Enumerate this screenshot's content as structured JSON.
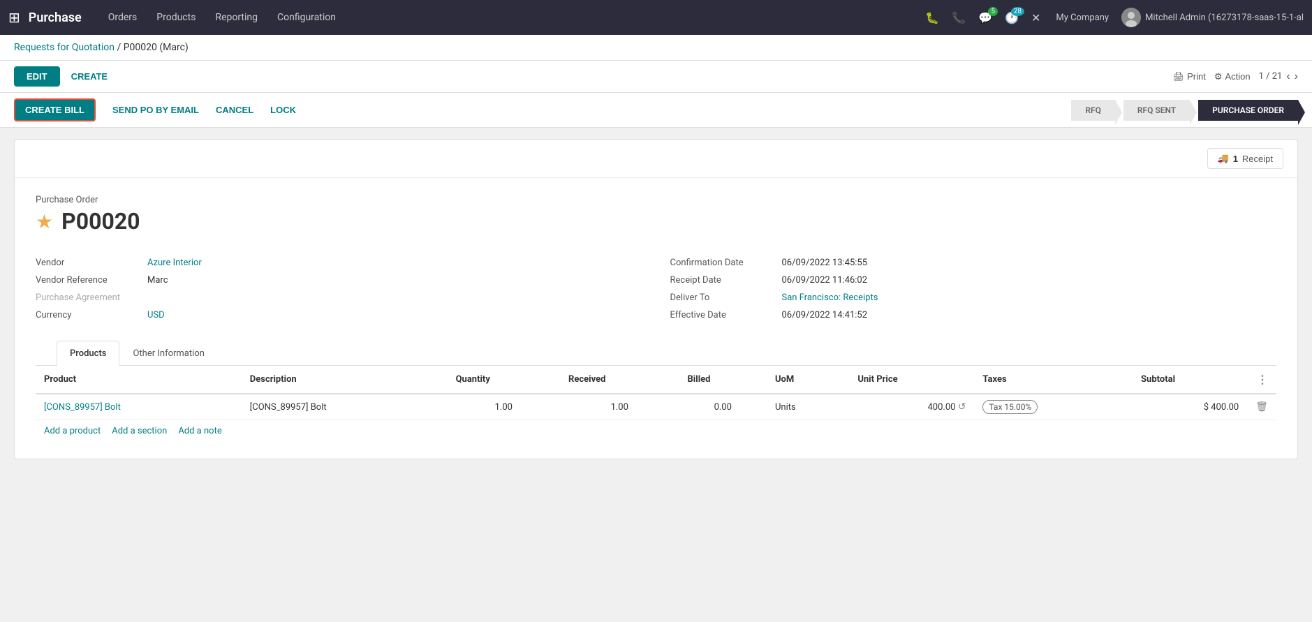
{
  "app": {
    "name": "Purchase",
    "grid_icon": "⊞"
  },
  "nav": {
    "items": [
      {
        "label": "Orders",
        "id": "orders"
      },
      {
        "label": "Products",
        "id": "products"
      },
      {
        "label": "Reporting",
        "id": "reporting"
      },
      {
        "label": "Configuration",
        "id": "configuration"
      }
    ]
  },
  "topbar": {
    "icons": [
      {
        "name": "bug-icon",
        "symbol": "🐛"
      },
      {
        "name": "phone-icon",
        "symbol": "📞"
      },
      {
        "name": "chat-icon",
        "symbol": "💬",
        "badge": "5",
        "badge_type": "green"
      },
      {
        "name": "clock-icon",
        "symbol": "🕐",
        "badge": "28",
        "badge_type": "blue"
      },
      {
        "name": "wrench-icon",
        "symbol": "✕"
      }
    ],
    "company": "My Company",
    "user": "Mitchell Admin (16273178-saas-15-1-al"
  },
  "breadcrumb": {
    "parent": "Requests for Quotation",
    "separator": "/",
    "current": "P00020 (Marc)"
  },
  "action_bar": {
    "edit_label": "EDIT",
    "create_label": "CREATE",
    "print_label": "Print",
    "action_label": "Action",
    "pagination": "1 / 21"
  },
  "status_bar": {
    "create_bill_label": "CREATE BILL",
    "send_po_label": "SEND PO BY EMAIL",
    "cancel_label": "CANCEL",
    "lock_label": "LOCK",
    "pipeline": [
      {
        "label": "RFQ",
        "active": false
      },
      {
        "label": "RFQ SENT",
        "active": false
      },
      {
        "label": "PURCHASE ORDER",
        "active": true
      }
    ]
  },
  "receipt": {
    "count": "1",
    "label": "Receipt",
    "truck_icon": "🚚"
  },
  "document": {
    "type_label": "Purchase Order",
    "star": "★",
    "order_number": "P00020"
  },
  "form": {
    "left": [
      {
        "label": "Vendor",
        "value": "Azure Interior",
        "is_link": true
      },
      {
        "label": "Vendor Reference",
        "value": "Marc",
        "is_link": false
      },
      {
        "label": "Purchase Agreement",
        "value": "",
        "is_link": false,
        "placeholder": ""
      },
      {
        "label": "Currency",
        "value": "USD",
        "is_link": true
      }
    ],
    "right": [
      {
        "label": "Confirmation Date",
        "value": "06/09/2022 13:45:55",
        "is_link": false
      },
      {
        "label": "Receipt Date",
        "value": "06/09/2022 11:46:02",
        "is_link": false
      },
      {
        "label": "Deliver To",
        "value": "San Francisco: Receipts",
        "is_link": true
      },
      {
        "label": "Effective Date",
        "value": "06/09/2022 14:41:52",
        "is_link": false
      }
    ]
  },
  "tabs": [
    {
      "label": "Products",
      "active": true
    },
    {
      "label": "Other Information",
      "active": false
    }
  ],
  "table": {
    "columns": [
      {
        "label": "Product"
      },
      {
        "label": "Description"
      },
      {
        "label": "Quantity"
      },
      {
        "label": "Received"
      },
      {
        "label": "Billed"
      },
      {
        "label": "UoM"
      },
      {
        "label": "Unit Price"
      },
      {
        "label": "Taxes"
      },
      {
        "label": "Subtotal"
      },
      {
        "label": "⋮",
        "is_menu": true
      }
    ],
    "rows": [
      {
        "product": "[CONS_89957] Bolt",
        "description": "[CONS_89957] Bolt",
        "quantity": "1.00",
        "received": "1.00",
        "billed": "0.00",
        "uom": "Units",
        "unit_price": "400.00",
        "has_reset": true,
        "taxes": "Tax 15.00%",
        "subtotal": "$ 400.00",
        "has_trash": true
      }
    ],
    "footer": {
      "add_product": "Add a product",
      "add_section": "Add a section",
      "add_note": "Add a note"
    }
  }
}
